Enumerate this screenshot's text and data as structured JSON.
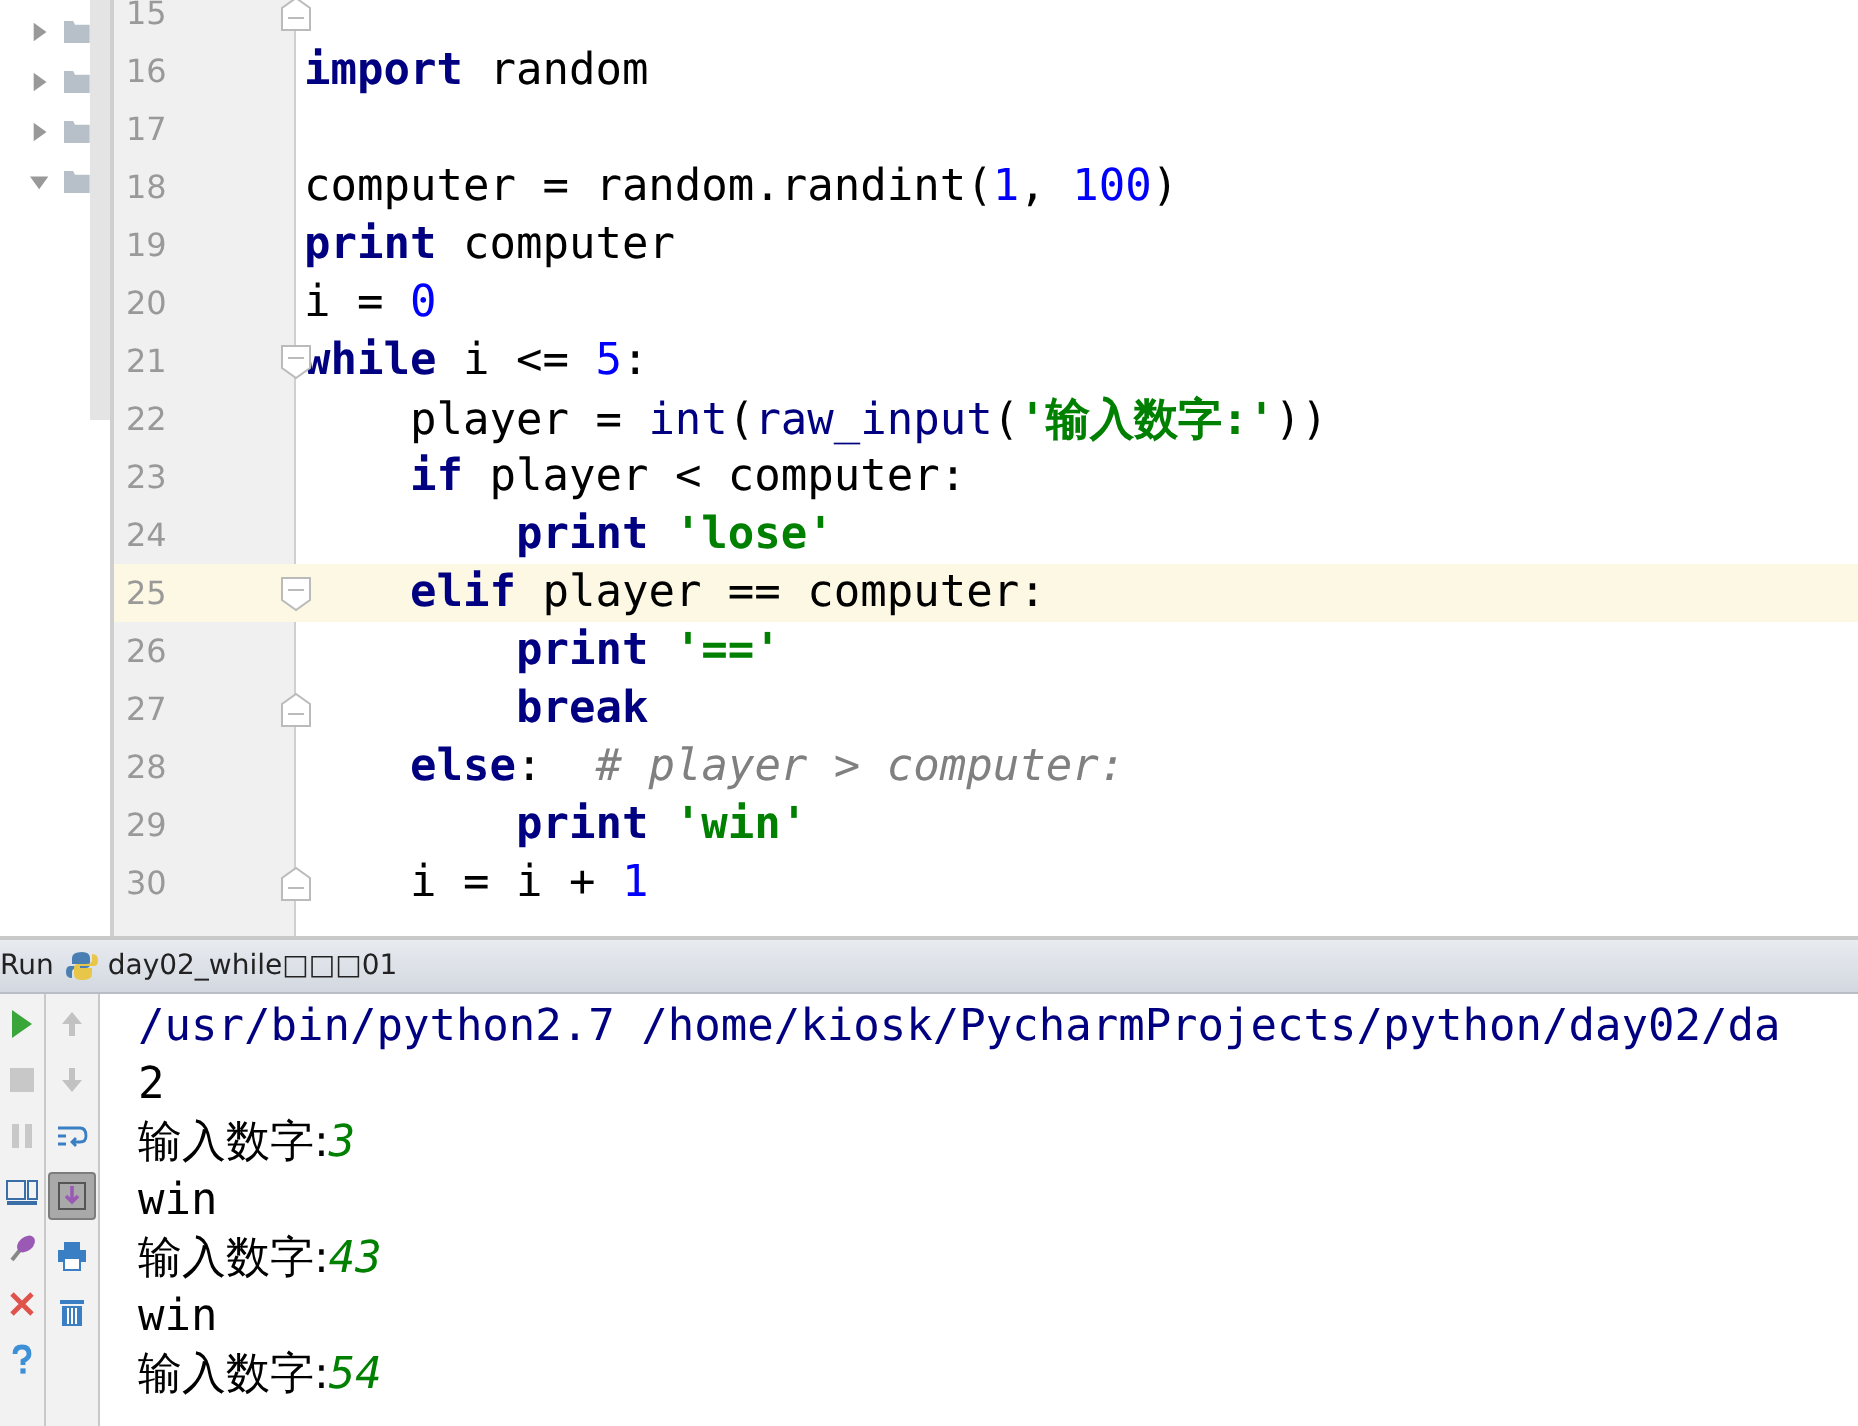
{
  "project_tree": [
    {
      "expanded": false
    },
    {
      "expanded": false
    },
    {
      "expanded": false
    },
    {
      "expanded": true
    }
  ],
  "editor": {
    "lines": [
      {
        "number": "15",
        "kind": "fold_end",
        "current": false
      },
      {
        "number": "16",
        "kind": "plain",
        "current": false,
        "tokens": [
          {
            "kind": "kw",
            "text": "import"
          },
          {
            "kind": "plain",
            "text": " random"
          }
        ]
      },
      {
        "number": "17",
        "kind": "plain",
        "current": false
      },
      {
        "number": "18",
        "kind": "plain",
        "current": false,
        "tokens": [
          {
            "kind": "plain",
            "text": "computer = random.randint("
          },
          {
            "kind": "num",
            "text": "1"
          },
          {
            "kind": "plain",
            "text": ", "
          },
          {
            "kind": "num",
            "text": "100"
          },
          {
            "kind": "plain",
            "text": ")"
          }
        ]
      },
      {
        "number": "19",
        "kind": "plain",
        "current": false,
        "tokens": [
          {
            "kind": "kw",
            "text": "print"
          },
          {
            "kind": "plain",
            "text": " computer"
          }
        ]
      },
      {
        "number": "20",
        "kind": "plain",
        "current": false,
        "tokens": [
          {
            "kind": "plain",
            "text": "i = "
          },
          {
            "kind": "num",
            "text": "0"
          }
        ]
      },
      {
        "number": "21",
        "kind": "fold_start",
        "current": false,
        "tokens": [
          {
            "kind": "kw",
            "text": "while"
          },
          {
            "kind": "plain",
            "text": " i <= "
          },
          {
            "kind": "num",
            "text": "5"
          },
          {
            "kind": "plain",
            "text": ":"
          }
        ]
      },
      {
        "number": "22",
        "kind": "plain",
        "current": false,
        "tokens": [
          {
            "kind": "plain",
            "text": "    player = "
          },
          {
            "kind": "builtin",
            "text": "int"
          },
          {
            "kind": "plain",
            "text": "("
          },
          {
            "kind": "builtin",
            "text": "raw_input"
          },
          {
            "kind": "plain",
            "text": "("
          },
          {
            "kind": "str",
            "text": "'输入数字:'"
          },
          {
            "kind": "plain",
            "text": "))"
          }
        ]
      },
      {
        "number": "23",
        "kind": "plain",
        "current": false,
        "tokens": [
          {
            "kind": "kw",
            "text": "    if"
          },
          {
            "kind": "plain",
            "text": " player < computer:"
          }
        ]
      },
      {
        "number": "24",
        "kind": "plain",
        "current": false,
        "tokens": [
          {
            "kind": "kw",
            "text": "        print"
          },
          {
            "kind": "str",
            "text": " 'lose'"
          }
        ]
      },
      {
        "number": "25",
        "kind": "fold_start",
        "current": true,
        "tokens": [
          {
            "kind": "kw",
            "text": "    elif"
          },
          {
            "kind": "plain",
            "text": " player == computer:"
          }
        ]
      },
      {
        "number": "26",
        "kind": "plain",
        "current": false,
        "tokens": [
          {
            "kind": "kw",
            "text": "        print"
          },
          {
            "kind": "str",
            "text": " '=='"
          }
        ]
      },
      {
        "number": "27",
        "kind": "fold_end",
        "current": false,
        "tokens": [
          {
            "kind": "kw",
            "text": "        break"
          }
        ]
      },
      {
        "number": "28",
        "kind": "plain",
        "current": false,
        "tokens": [
          {
            "kind": "kw",
            "text": "    else"
          },
          {
            "kind": "plain",
            "text": ":  "
          },
          {
            "kind": "comment",
            "text": "# player > computer:"
          }
        ]
      },
      {
        "number": "29",
        "kind": "plain",
        "current": false,
        "tokens": [
          {
            "kind": "kw",
            "text": "        print"
          },
          {
            "kind": "str",
            "text": " 'win'"
          }
        ]
      },
      {
        "number": "30",
        "kind": "fold_end",
        "current": false,
        "tokens": [
          {
            "kind": "plain",
            "text": "    i = i + "
          },
          {
            "kind": "num",
            "text": "1"
          }
        ]
      }
    ]
  },
  "run_panel": {
    "label": "Run",
    "tab_title": "day02_while□□□01",
    "toolbar": [
      {
        "kind": "run",
        "selected": false
      },
      {
        "kind": "stop",
        "selected": false
      },
      {
        "kind": "pause",
        "selected": false
      },
      {
        "kind": "layout",
        "selected": false
      },
      {
        "kind": "pin",
        "selected": false
      },
      {
        "kind": "close",
        "selected": false
      },
      {
        "kind": "help",
        "selected": false
      }
    ],
    "toolbar_2": [
      {
        "kind": "up",
        "selected": false
      },
      {
        "kind": "down",
        "selected": false
      },
      {
        "kind": "wrap",
        "selected": false
      },
      {
        "kind": "scroll-end",
        "selected": true
      },
      {
        "kind": "print",
        "selected": false
      },
      {
        "kind": "trash",
        "selected": false
      }
    ],
    "console": [
      {
        "kind": "path",
        "text": "/usr/bin/python2.7 /home/kiosk/PycharmProjects/python/day02/da"
      },
      {
        "kind": "output",
        "text": "2"
      },
      {
        "kind": "prompt",
        "text": "输入数字:",
        "input": "3"
      },
      {
        "kind": "output",
        "text": "win"
      },
      {
        "kind": "prompt",
        "text": "输入数字:",
        "input": "43"
      },
      {
        "kind": "output",
        "text": "win"
      },
      {
        "kind": "prompt",
        "text": "输入数字:",
        "input": "54"
      }
    ]
  }
}
